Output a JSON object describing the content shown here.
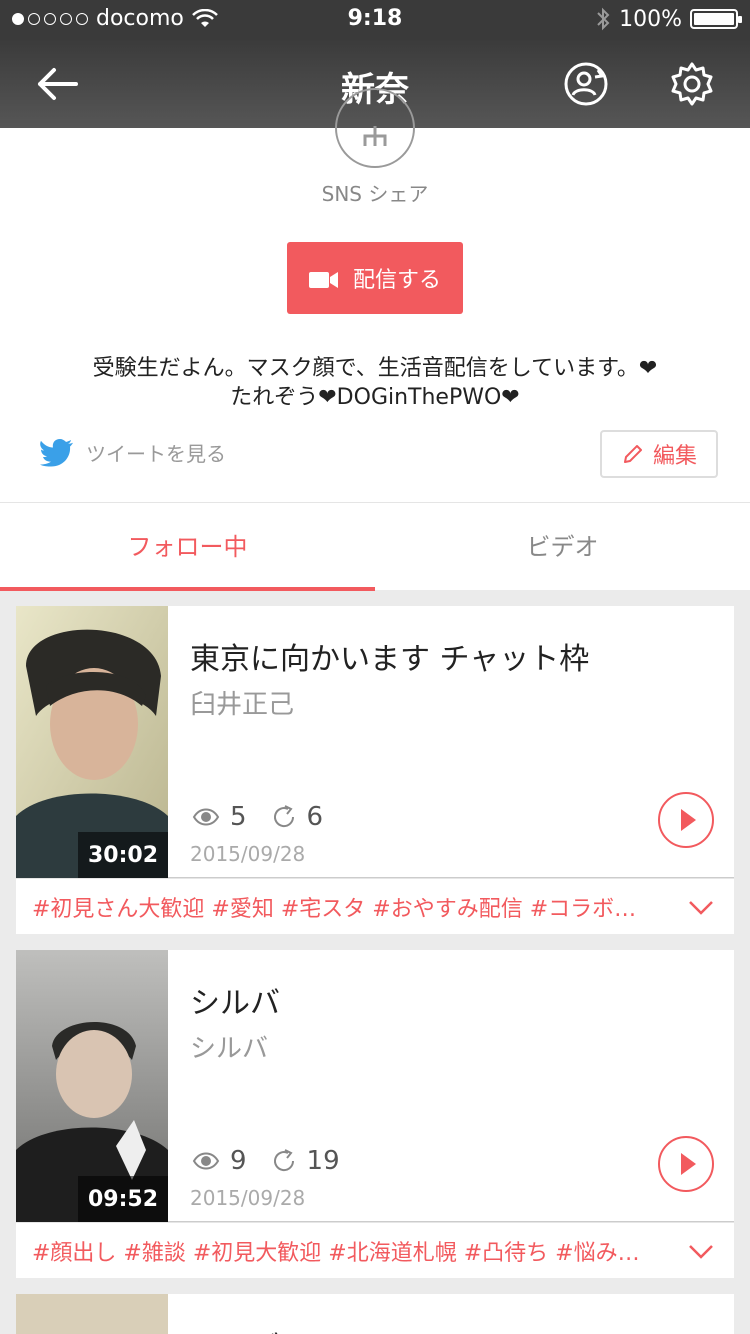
{
  "status": {
    "carrier": "docomo",
    "time": "9:18",
    "battery": "100%"
  },
  "navbar": {
    "title": "新奈",
    "icons": [
      "back-arrow-icon",
      "user-refresh-icon",
      "gear-icon"
    ]
  },
  "profile": {
    "share_label": "SNS シェア",
    "broadcast_button": "配信する",
    "bio_line1": "受験生だよん。マスク顔で、生活音配信をしています。❤",
    "bio_line2": "たれぞう❤DOGinThePWO❤",
    "tweet_link": "ツイートを見る",
    "edit_button": "編集"
  },
  "tabs": [
    {
      "label": "フォロー中",
      "active": true
    },
    {
      "label": "ビデオ",
      "active": false
    }
  ],
  "videos": [
    {
      "title": "東京に向かいます チャット枠",
      "user": "臼井正己",
      "views": "5",
      "replays": "6",
      "date": "2015/09/28",
      "duration": "30:02",
      "tags": "#初見さん大歓迎 #愛知 #宅スタ #おやすみ配信 #コラボ…"
    },
    {
      "title": "シルバ",
      "user": "シルバ",
      "views": "9",
      "replays": "19",
      "date": "2015/09/28",
      "duration": "09:52",
      "tags": "#顔出し #雑談 #初見大歓迎 #北海道札幌 #凸待ち #悩み…"
    },
    {
      "title": "シルバ"
    }
  ],
  "colors": {
    "accent": "#f25a5e",
    "navbar": "#3b3b3b"
  }
}
